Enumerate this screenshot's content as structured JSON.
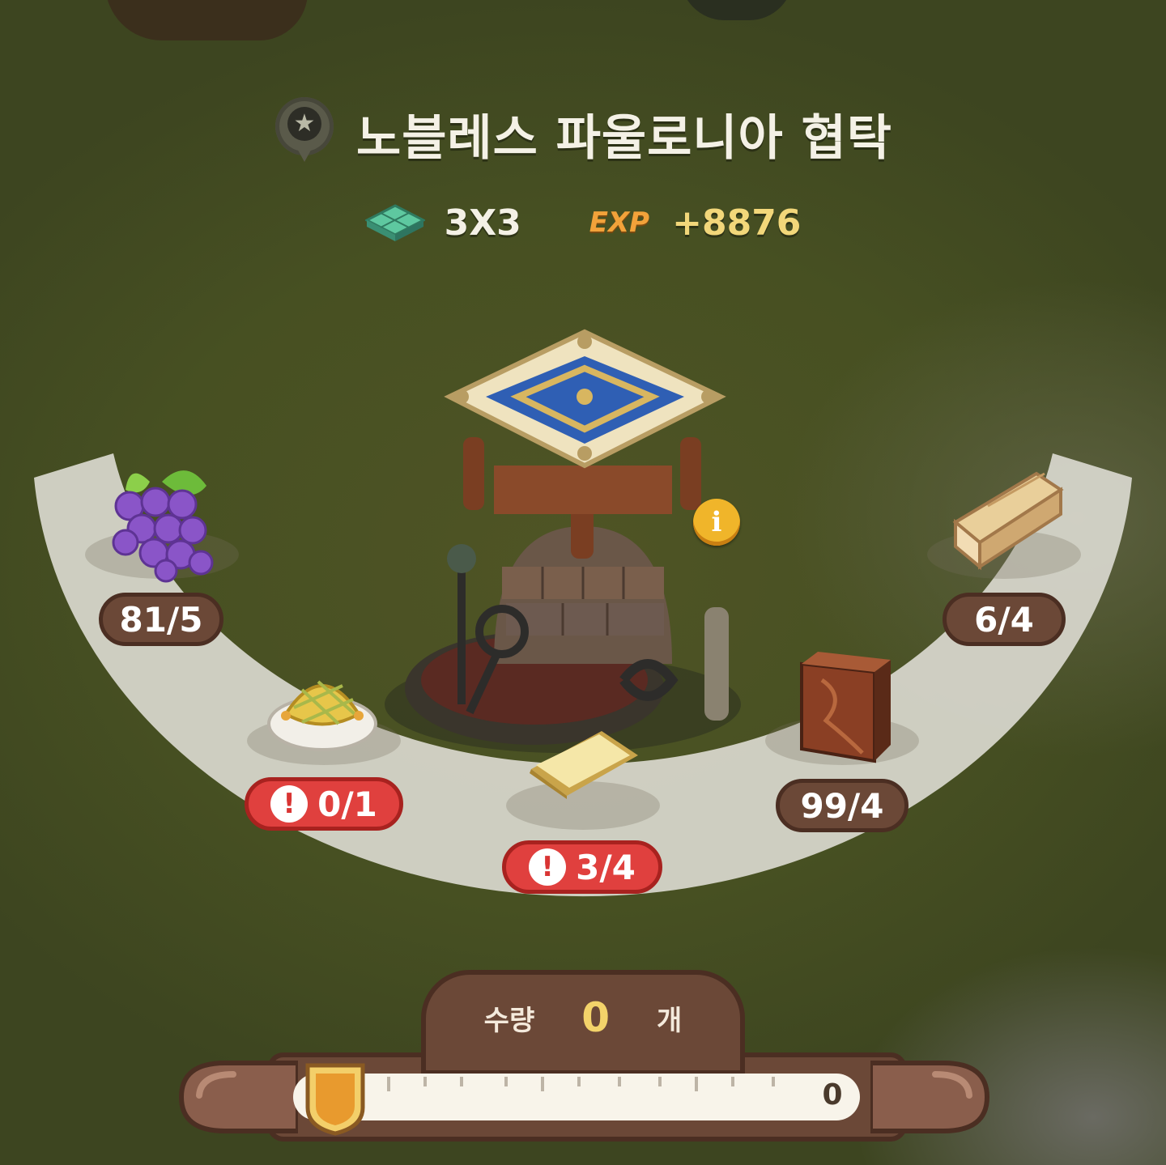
{
  "header": {
    "title": "노블레스 파울로니아 협탁",
    "size": "3X3",
    "exp_label": "EXP",
    "exp_value": "+8876"
  },
  "icons": {
    "title_icon": "star-pin-icon",
    "size_icon": "floor-tile-icon",
    "info_icon": "info-icon",
    "warning_icon": "exclamation-icon"
  },
  "materials": [
    {
      "name": "grape-icon",
      "count": "81/5",
      "insufficient": false
    },
    {
      "name": "checkered-cushion-icon",
      "count": "0/1",
      "insufficient": true
    },
    {
      "name": "gold-bar-icon",
      "count": "3/4",
      "insufficient": true
    },
    {
      "name": "plank-icon",
      "count": "99/4",
      "insufficient": false
    },
    {
      "name": "log-icon",
      "count": "6/4",
      "insufficient": false
    }
  ],
  "quantity": {
    "label": "수량",
    "value": "0",
    "unit": "개",
    "slider_max_label": "0",
    "slider_fraction": 0
  },
  "colors": {
    "background": "#4b5223",
    "ring": "#d8d7cd",
    "counter": "#6b4837",
    "counter_warning": "#e0403e",
    "exp": "#f2a23a",
    "accent_gold": "#f3d36a"
  },
  "exclamation_mark": "!",
  "info_glyph": "i",
  "star_glyph": "★"
}
